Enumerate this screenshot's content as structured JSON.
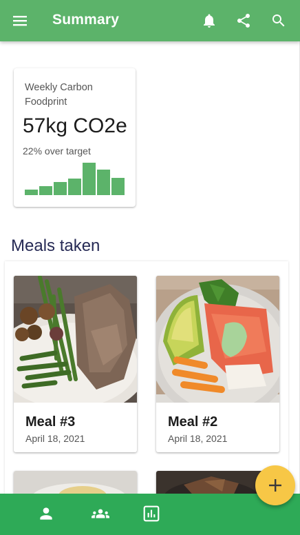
{
  "appbar": {
    "title": "Summary",
    "menu_icon": "menu-icon",
    "actions": [
      "bell-icon",
      "share-icon",
      "search-icon"
    ],
    "color": "#5cb36a"
  },
  "carbon_card": {
    "label": "Weekly Carbon Foodprint",
    "value": "57kg CO2e",
    "target_text": "22% over target",
    "daily_bars": [
      0.17,
      0.28,
      0.4,
      0.52,
      1.0,
      0.78,
      0.53
    ]
  },
  "meals": {
    "section_title": "Meals taken",
    "items": [
      {
        "name": "Meal #3",
        "date": "April 18, 2021"
      },
      {
        "name": "Meal #2",
        "date": "April 18, 2021"
      }
    ]
  },
  "bottom_nav": {
    "items": [
      "person-icon",
      "group-icon",
      "bar-chart-icon"
    ],
    "color": "#2eaa57"
  },
  "fab": {
    "icon": "plus-icon",
    "color": "#f7c746"
  }
}
